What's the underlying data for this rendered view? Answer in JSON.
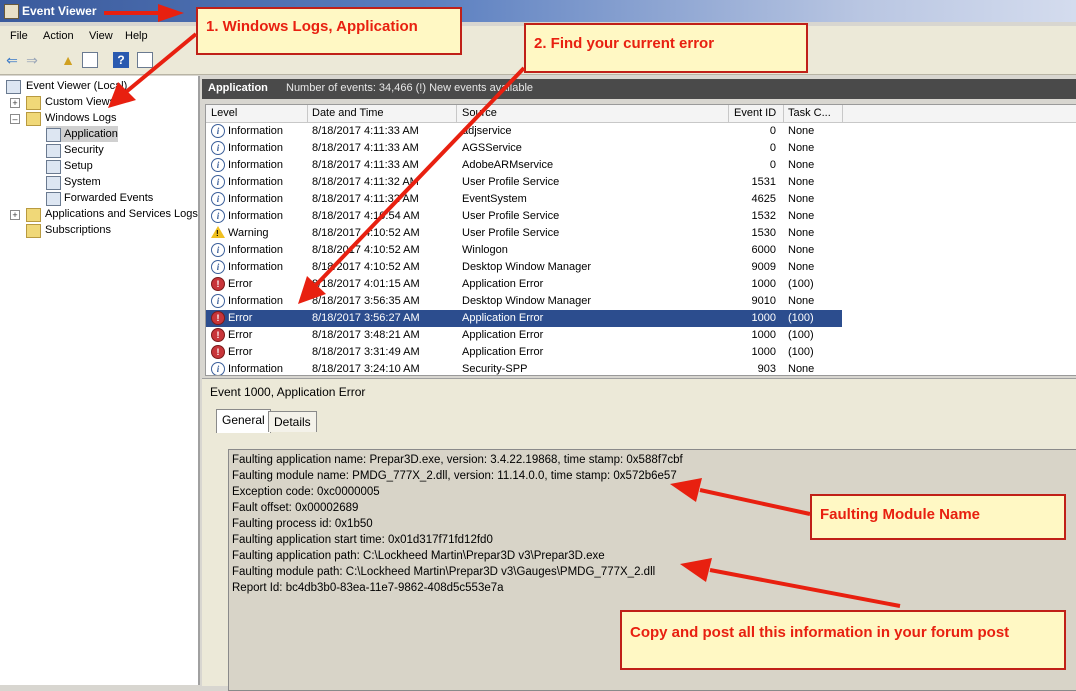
{
  "window": {
    "title": "Event Viewer"
  },
  "menu": [
    "File",
    "Action",
    "View",
    "Help"
  ],
  "tree": {
    "root": "Event Viewer (Local)",
    "custom_views": "Custom Views",
    "windows_logs": "Windows Logs",
    "logs": [
      "Application",
      "Security",
      "Setup",
      "System",
      "Forwarded Events"
    ],
    "apps_services": "Applications and Services Logs",
    "subscriptions": "Subscriptions"
  },
  "header": {
    "name": "Application",
    "count_text": "Number of events: 34,466 (!) New events available"
  },
  "columns": [
    "Level",
    "Date and Time",
    "Source",
    "Event ID",
    "Task C..."
  ],
  "events": [
    {
      "level": "Information",
      "date": "8/18/2017 4:11:33 AM",
      "source": "adjservice",
      "id": "0",
      "task": "None"
    },
    {
      "level": "Information",
      "date": "8/18/2017 4:11:33 AM",
      "source": "AGSService",
      "id": "0",
      "task": "None"
    },
    {
      "level": "Information",
      "date": "8/18/2017 4:11:33 AM",
      "source": "AdobeARMservice",
      "id": "0",
      "task": "None"
    },
    {
      "level": "Information",
      "date": "8/18/2017 4:11:32 AM",
      "source": "User Profile Service",
      "id": "1531",
      "task": "None"
    },
    {
      "level": "Information",
      "date": "8/18/2017 4:11:32 AM",
      "source": "EventSystem",
      "id": "4625",
      "task": "None"
    },
    {
      "level": "Information",
      "date": "8/18/2017 4:10:54 AM",
      "source": "User Profile Service",
      "id": "1532",
      "task": "None"
    },
    {
      "level": "Warning",
      "date": "8/18/2017 4:10:52 AM",
      "source": "User Profile Service",
      "id": "1530",
      "task": "None"
    },
    {
      "level": "Information",
      "date": "8/18/2017 4:10:52 AM",
      "source": "Winlogon",
      "id": "6000",
      "task": "None"
    },
    {
      "level": "Information",
      "date": "8/18/2017 4:10:52 AM",
      "source": "Desktop Window Manager",
      "id": "9009",
      "task": "None"
    },
    {
      "level": "Error",
      "date": "8/18/2017 4:01:15 AM",
      "source": "Application Error",
      "id": "1000",
      "task": "(100)"
    },
    {
      "level": "Information",
      "date": "8/18/2017 3:56:35 AM",
      "source": "Desktop Window Manager",
      "id": "9010",
      "task": "None"
    },
    {
      "level": "Error",
      "date": "8/18/2017 3:56:27 AM",
      "source": "Application Error",
      "id": "1000",
      "task": "(100)",
      "selected": true
    },
    {
      "level": "Error",
      "date": "8/18/2017 3:48:21 AM",
      "source": "Application Error",
      "id": "1000",
      "task": "(100)"
    },
    {
      "level": "Error",
      "date": "8/18/2017 3:31:49 AM",
      "source": "Application Error",
      "id": "1000",
      "task": "(100)"
    },
    {
      "level": "Information",
      "date": "8/18/2017 3:24:10 AM",
      "source": "Security-SPP",
      "id": "903",
      "task": "None"
    }
  ],
  "details": {
    "heading": "Event 1000, Application Error",
    "tabs": [
      "General",
      "Details"
    ],
    "lines": [
      "Faulting application name: Prepar3D.exe, version: 3.4.22.19868, time stamp: 0x588f7cbf",
      "Faulting module name: PMDG_777X_2.dll, version: 11.14.0.0, time stamp: 0x572b6e57",
      "Exception code: 0xc0000005",
      "Fault offset: 0x00002689",
      "Faulting process id: 0x1b50",
      "Faulting application start time: 0x01d317f71fd12fd0",
      "Faulting application path: C:\\Lockheed Martin\\Prepar3D v3\\Prepar3D.exe",
      "Faulting module path: C:\\Lockheed Martin\\Prepar3D v3\\Gauges\\PMDG_777X_2.dll",
      "Report Id: bc4db3b0-83ea-11e7-9862-408d5c553e7a"
    ]
  },
  "annotations": {
    "step1": "1. Windows Logs, Application",
    "step2": "2. Find your current error",
    "module": "Faulting Module Name",
    "copy": "Copy and post all this information in your forum post"
  },
  "colors": {
    "selection": "#2c4d8e",
    "annotation_red": "#e82010",
    "callout_bg": "#fff8c4"
  }
}
